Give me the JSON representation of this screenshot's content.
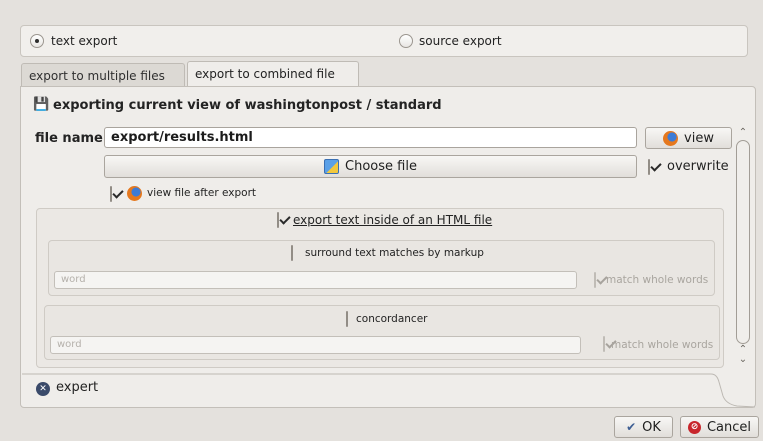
{
  "mode": {
    "text_export": "text export",
    "source_export": "source export"
  },
  "tabs": [
    {
      "label": "export to multiple files"
    },
    {
      "label": "export to combined file"
    }
  ],
  "header": {
    "title": "exporting current view of washingtonpost / standard"
  },
  "file": {
    "label": "file name",
    "value": "export/results.html",
    "view_label": "view",
    "choose_label": "Choose file",
    "overwrite_label": "overwrite",
    "view_after_label": "view file after export"
  },
  "html_option": {
    "label": "export text inside of an HTML file"
  },
  "markup": {
    "label": "surround text matches by markup",
    "placeholder": "word",
    "match_label": "match whole words"
  },
  "concordancer": {
    "label": "concordancer",
    "placeholder": "word",
    "match_label": "match whole words"
  },
  "expert": {
    "label": "expert"
  },
  "footer": {
    "ok_label": "OK",
    "cancel_label": "Cancel"
  }
}
